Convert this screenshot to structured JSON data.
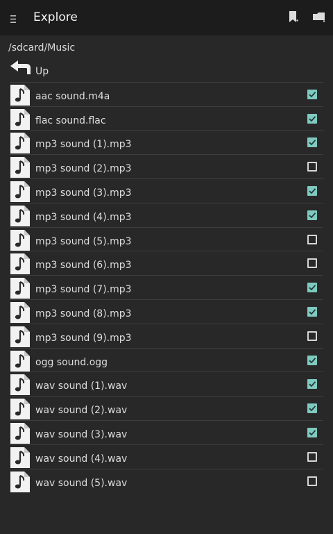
{
  "appbar": {
    "menu_icon": "menu-icon",
    "title": "Explore",
    "actions": [
      "bookmark-icon",
      "folder-icon"
    ]
  },
  "path": "/sdcard/Music",
  "up_label": "Up",
  "files": [
    {
      "name": "aac sound.m4a",
      "checked": true
    },
    {
      "name": "flac sound.flac",
      "checked": true
    },
    {
      "name": "mp3 sound (1).mp3",
      "checked": true
    },
    {
      "name": "mp3 sound (2).mp3",
      "checked": false
    },
    {
      "name": "mp3 sound (3).mp3",
      "checked": true
    },
    {
      "name": "mp3 sound (4).mp3",
      "checked": true
    },
    {
      "name": "mp3 sound (5).mp3",
      "checked": false
    },
    {
      "name": "mp3 sound (6).mp3",
      "checked": false
    },
    {
      "name": "mp3 sound (7).mp3",
      "checked": true
    },
    {
      "name": "mp3 sound (8).mp3",
      "checked": true
    },
    {
      "name": "mp3 sound (9).mp3",
      "checked": false
    },
    {
      "name": "ogg sound.ogg",
      "checked": true
    },
    {
      "name": "wav sound (1).wav",
      "checked": true
    },
    {
      "name": "wav sound (2).wav",
      "checked": true
    },
    {
      "name": "wav sound (3).wav",
      "checked": true
    },
    {
      "name": "wav sound (4).wav",
      "checked": false
    },
    {
      "name": "wav sound (5).wav",
      "checked": false
    }
  ],
  "colors": {
    "checkbox_checked": "#7fc9c0",
    "background": "#282828",
    "appbar": "#1c1c1c"
  }
}
